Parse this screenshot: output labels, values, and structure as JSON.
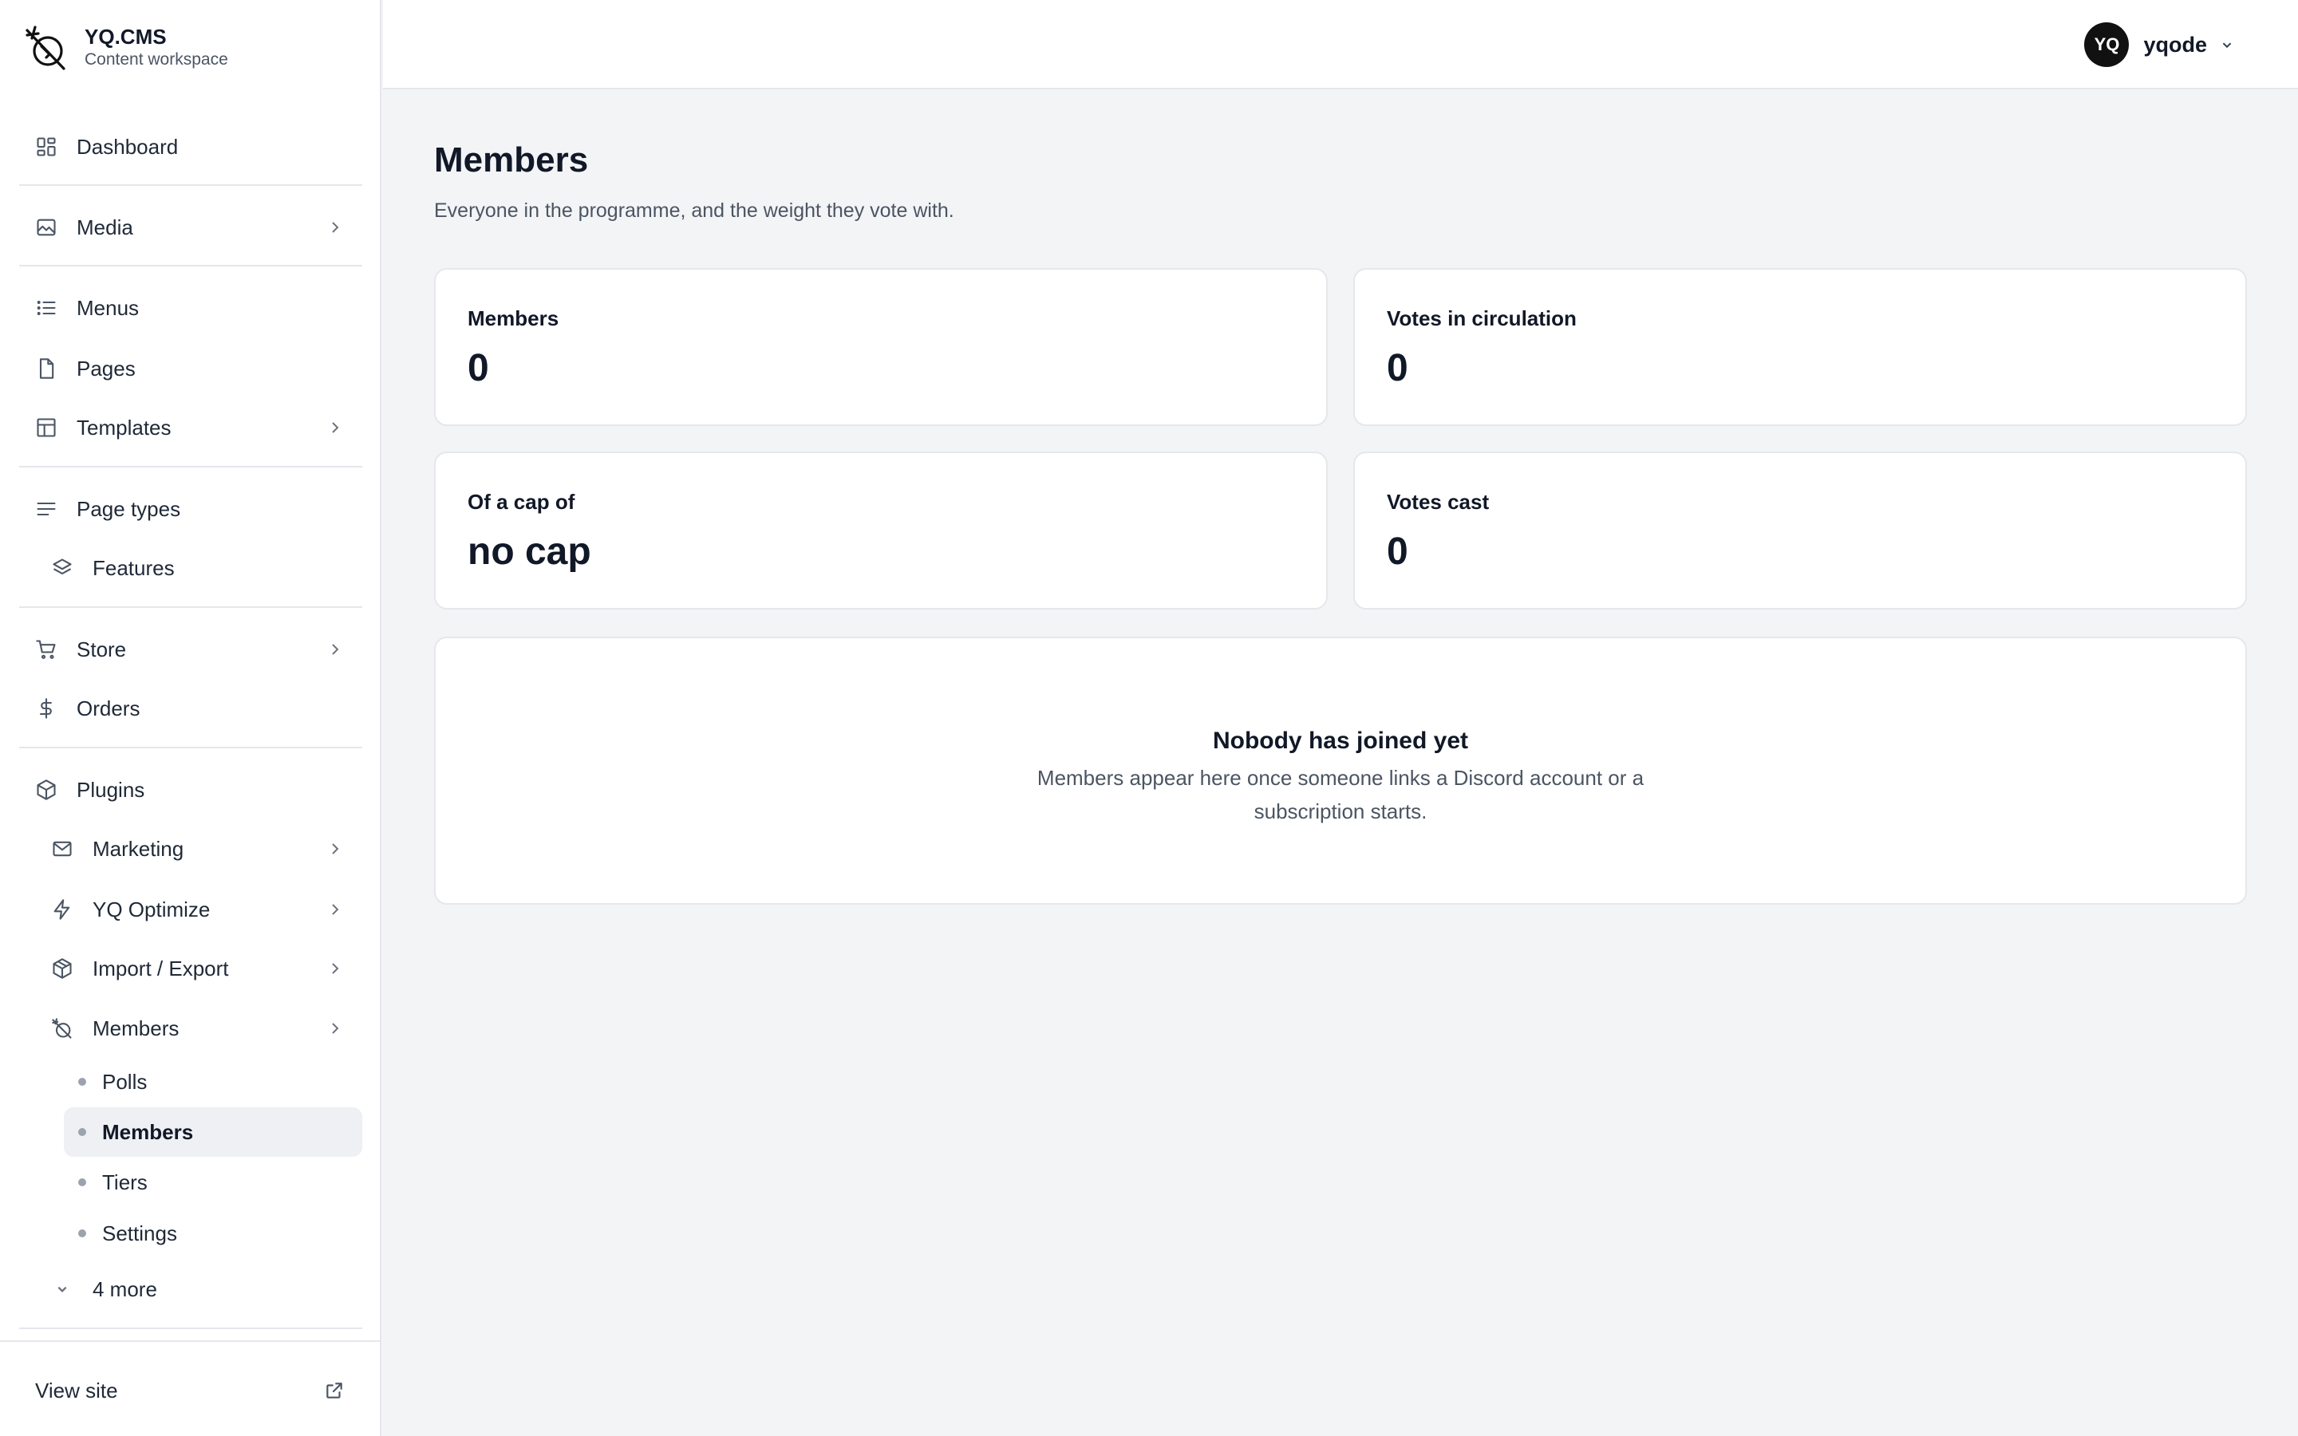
{
  "brand": {
    "name": "YQ.CMS",
    "subtitle": "Content workspace",
    "logo_icon": "no-tracking-logo-icon"
  },
  "sidebar": {
    "items": [
      {
        "label": "Dashboard",
        "icon": "dashboard-icon"
      },
      {
        "label": "Media",
        "icon": "image-icon"
      },
      {
        "label": "Menus",
        "icon": "list-icon"
      },
      {
        "label": "Pages",
        "icon": "file-icon"
      },
      {
        "label": "Templates",
        "icon": "layout-icon"
      },
      {
        "label": "Page types",
        "icon": "text-lines-icon"
      },
      {
        "label": "Features",
        "icon": "layers-icon"
      },
      {
        "label": "Store",
        "icon": "cart-icon"
      },
      {
        "label": "Orders",
        "icon": "dollar-icon"
      },
      {
        "label": "Plugins",
        "icon": "box-icon"
      },
      {
        "label": "Marketing",
        "icon": "mail-icon"
      },
      {
        "label": "YQ Optimize",
        "icon": "zap-icon"
      },
      {
        "label": "Import / Export",
        "icon": "package-icon"
      },
      {
        "label": "Members",
        "icon": "no-tracking-icon"
      }
    ],
    "members_sub": [
      {
        "label": "Polls"
      },
      {
        "label": "Members",
        "active": true
      },
      {
        "label": "Tiers"
      },
      {
        "label": "Settings"
      }
    ],
    "more_label": "4 more",
    "view_site": "View site"
  },
  "topbar": {
    "avatar_initials": "YQ",
    "username": "yqode"
  },
  "main": {
    "title": "Members",
    "subtitle": "Everyone in the programme, and the weight they vote with.",
    "stats": [
      {
        "label": "Members",
        "value": "0"
      },
      {
        "label": "Votes in circulation",
        "value": "0"
      },
      {
        "label": "Of a cap of",
        "value": "no cap"
      },
      {
        "label": "Votes cast",
        "value": "0"
      }
    ],
    "empty": {
      "title": "Nobody has joined yet",
      "text": "Members appear here once someone links a Discord account or a subscription starts."
    }
  },
  "colors": {
    "background": "#f3f4f6",
    "surface": "#ffffff",
    "border": "#e5e7eb",
    "text": "#111827",
    "muted": "#4b5563",
    "active_bg": "#eef0f3",
    "avatar_bg": "#111111"
  }
}
